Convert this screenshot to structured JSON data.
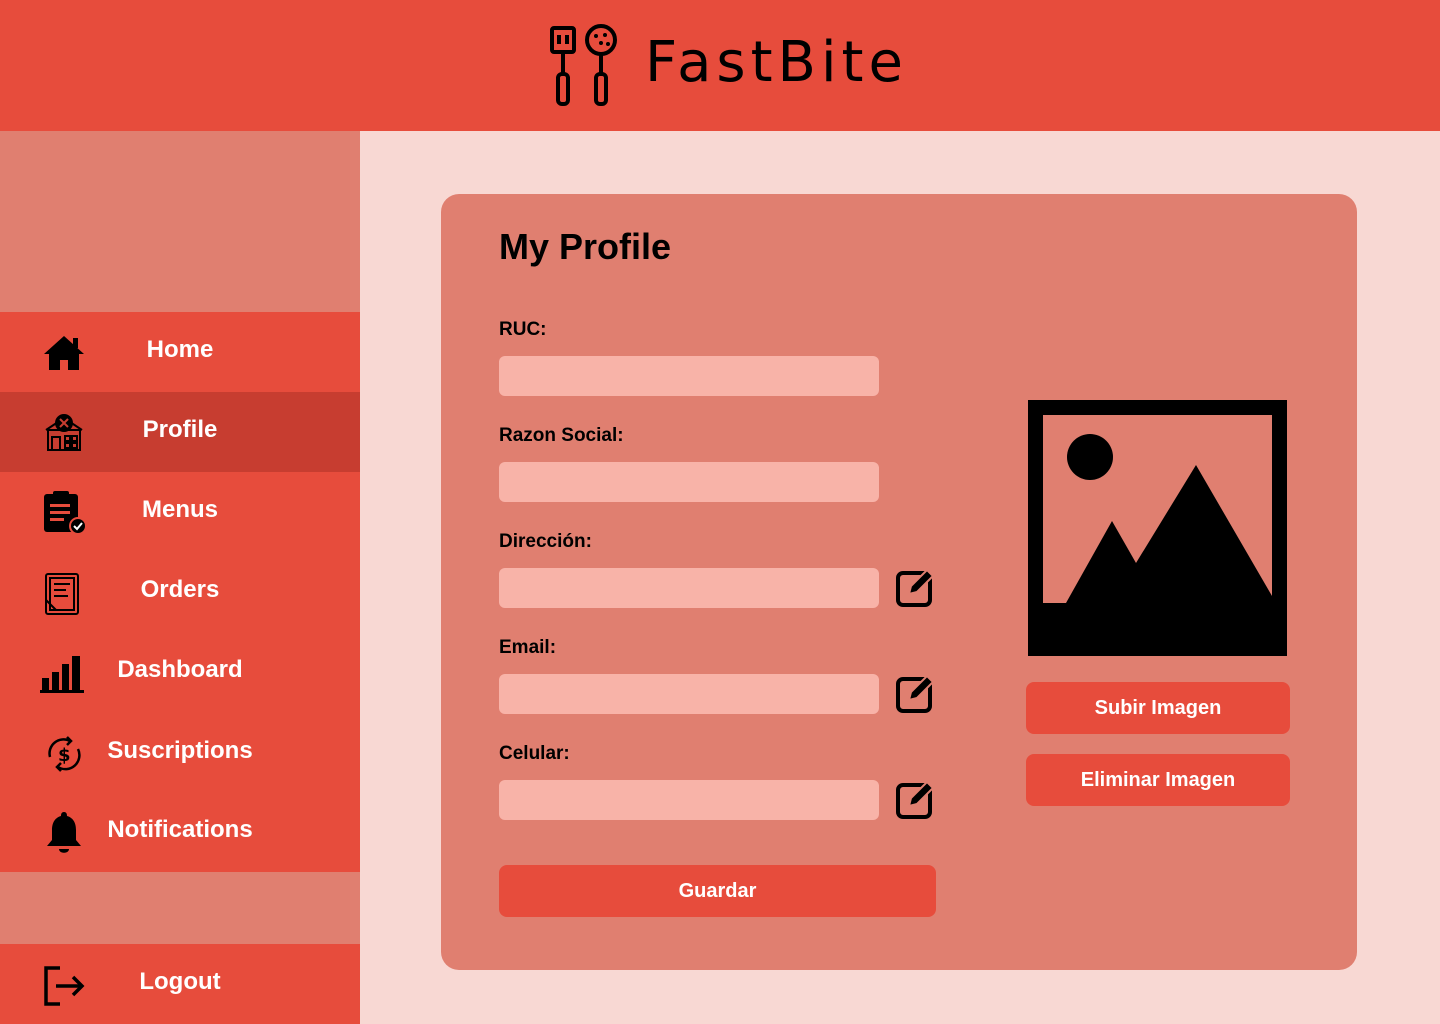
{
  "header": {
    "brand": "FastBite",
    "logo_icon": "kitchen-utensils-icon",
    "background": "#e74c3c"
  },
  "sidebar": {
    "items": [
      {
        "label": "Home",
        "icon": "home-icon",
        "active": false
      },
      {
        "label": "Profile",
        "icon": "restaurant-store-icon",
        "active": true
      },
      {
        "label": "Menus",
        "icon": "clipboard-check-icon",
        "active": false
      },
      {
        "label": "Orders",
        "icon": "order-list-icon",
        "active": false
      },
      {
        "label": "Dashboard",
        "icon": "bar-chart-icon",
        "active": false
      },
      {
        "label": "Suscriptions",
        "icon": "subscription-dollar-icon",
        "active": false
      },
      {
        "label": "Notifications",
        "icon": "bell-icon",
        "active": false
      }
    ],
    "logout": {
      "label": "Logout",
      "icon": "logout-icon"
    }
  },
  "profile": {
    "title": "My Profile",
    "fields": [
      {
        "label": "RUC:",
        "value": "",
        "editable": false
      },
      {
        "label": "Razon Social:",
        "value": "",
        "editable": false
      },
      {
        "label": "Dirección:",
        "value": "",
        "editable": true
      },
      {
        "label": "Email:",
        "value": "",
        "editable": true
      },
      {
        "label": "Celular:",
        "value": "",
        "editable": true
      }
    ],
    "save_label": "Guardar",
    "upload_label": "Subir Imagen",
    "delete_label": "Eliminar Imagen",
    "image_icon": "image-placeholder-icon"
  },
  "colors": {
    "accent": "#e74c3c",
    "active_nav": "#c73d30",
    "card": "#e07f70",
    "input": "#f8b3a8",
    "page_bg": "#f8d8d3"
  }
}
